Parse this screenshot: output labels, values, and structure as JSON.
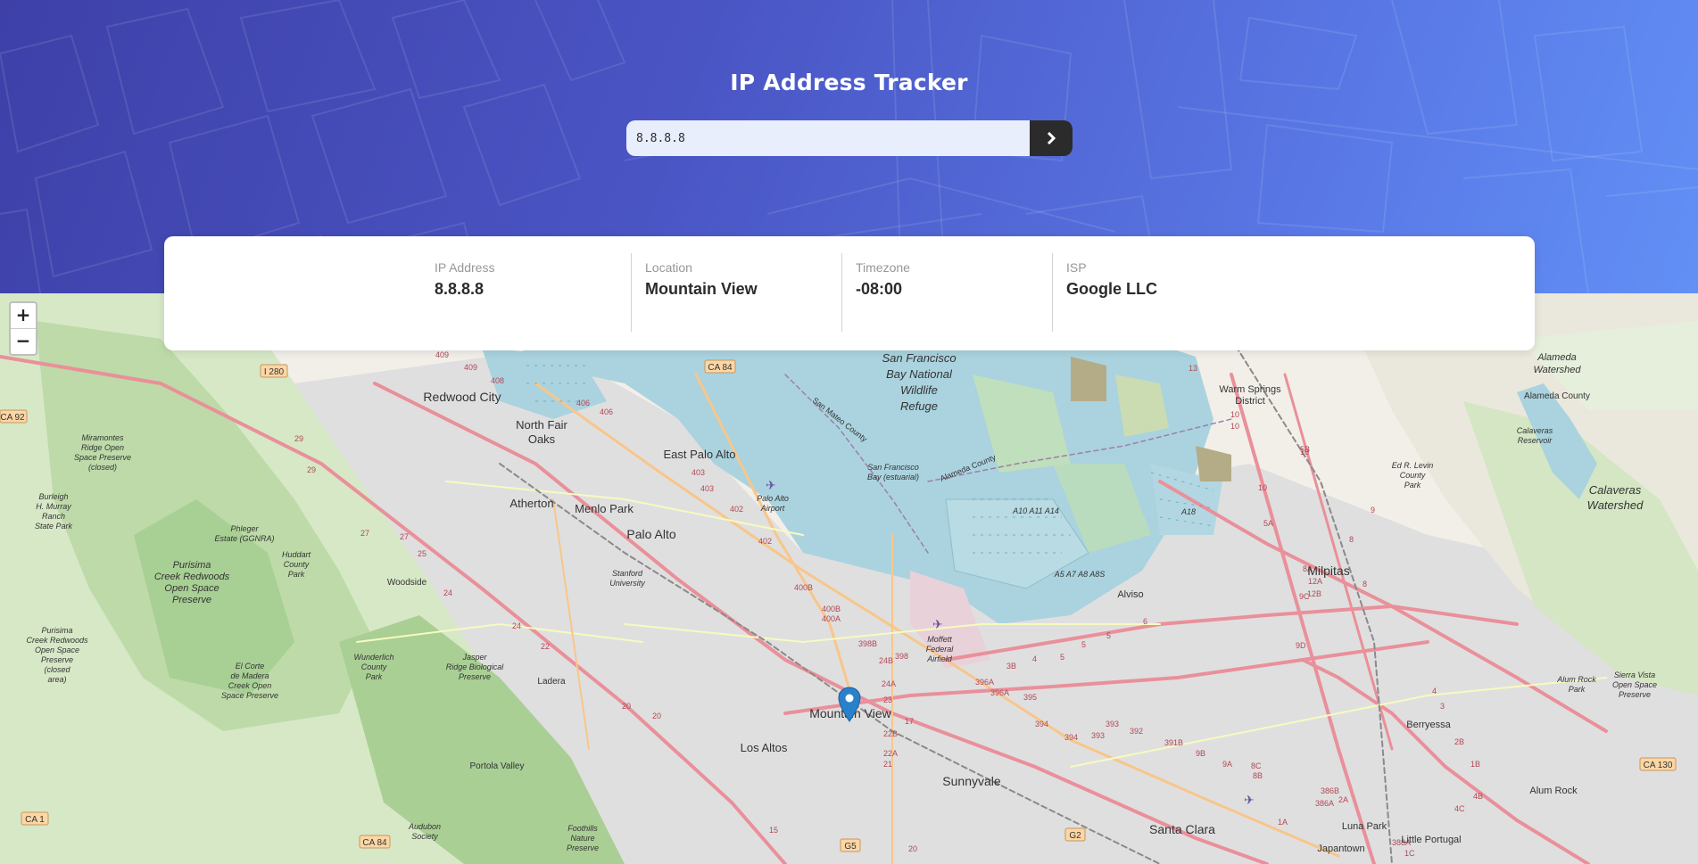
{
  "header": {
    "title": "IP Address Tracker",
    "search": {
      "value": "8.8.8.8",
      "submit_icon": "chevron-right-icon"
    }
  },
  "info": {
    "ip": {
      "label": "IP Address",
      "value": "8.8.8.8"
    },
    "location": {
      "label": "Location",
      "value": "Mountain View"
    },
    "timezone": {
      "label": "Timezone",
      "value": "-08:00"
    },
    "isp": {
      "label": "ISP",
      "value": "Google LLC"
    }
  },
  "map": {
    "zoom_in": "+",
    "zoom_out": "−",
    "marker_icon": "map-pin-icon",
    "labels": {
      "sf_refuge": [
        "San Francisco",
        "Bay National",
        "Wildlife",
        "Refuge"
      ],
      "redwood_city": "Redwood City",
      "north_fair_oaks": [
        "North Fair",
        "Oaks"
      ],
      "east_palo_alto": "East Palo Alto",
      "atherton": "Atherton",
      "menlo_park": "Menlo Park",
      "palo_alto": "Palo Alto",
      "palo_alto_airport": [
        "Palo Alto",
        "Airport"
      ],
      "stanford": [
        "Stanford",
        "University"
      ],
      "woodside": "Woodside",
      "mountain_view": "Mountain View",
      "los_altos": "Los Altos",
      "sunnyvale": "Sunnyvale",
      "santa_clara": "Santa Clara",
      "milpitas": "Milpitas",
      "alviso": "Alviso",
      "berryessa": "Berryessa",
      "alum_rock": "Alum Rock",
      "luna_park": "Luna Park",
      "little_portugal": "Little Portugal",
      "japantown": "Japantown",
      "warm_springs": [
        "Warm Springs",
        "District"
      ],
      "alameda_watershed": [
        "Alameda",
        "Watershed"
      ],
      "alameda_county": "Alameda County",
      "calaveras_watershed": [
        "Calaveras",
        "Watershed"
      ],
      "calaveras_reservoir": [
        "Calaveras",
        "Reservoir"
      ],
      "ed_levin": [
        "Ed R. Levin",
        "County",
        "Park"
      ],
      "moffett": [
        "Moffett",
        "Federal",
        "Airfield"
      ],
      "ladera": "Ladera",
      "portola_valley": "Portola Valley",
      "purisima": [
        "Purisima",
        "Creek Redwoods",
        "Open Space",
        "Preserve"
      ],
      "huddart": [
        "Huddart",
        "County",
        "Park"
      ],
      "phleger": [
        "Phleger",
        "Estate (GGNRA)"
      ],
      "jasper_ridge": [
        "Jasper",
        "Ridge Biological",
        "Preserve"
      ],
      "wunderlich": [
        "Wunderlich",
        "County",
        "Park"
      ],
      "el_corte": [
        "El Corte",
        "de Madera",
        "Creek Open",
        "Space Preserve"
      ],
      "mira_montes": [
        "Miramontes",
        "Ridge Open",
        "Space Preserve",
        "(closed)"
      ],
      "burleigh": [
        "Burleigh",
        "H. Murray",
        "Ranch",
        "State Park"
      ],
      "purisima_closed": [
        "Purisima",
        "Creek Redwoods",
        "Open Space",
        "Preserve",
        "(closed",
        "area)"
      ],
      "audubon": [
        "Audubon",
        "Society"
      ],
      "foothills": [
        "Foothills",
        "Nature",
        "Preserve"
      ],
      "alum_rock_park": [
        "Alum Rock",
        "Park"
      ],
      "sierra_vista": [
        "Sierra Vista",
        "Open Space",
        "Preserve"
      ],
      "sf_bay_estuarial": [
        "San Francisco",
        "Bay (estuarial)"
      ],
      "san_mateo_county": "San Mateo County",
      "alameda_county_line": "Alameda County",
      "a10": "A10 A11 A14",
      "a18": "A18",
      "a5": "A5 A7 A8 A8S"
    },
    "shields": [
      "I 280",
      "CA 84",
      "CA 92",
      "CA 1",
      "CA 84",
      "G5",
      "G2",
      "CA 130"
    ],
    "route_numbers": [
      "409",
      "409",
      "408",
      "406",
      "406",
      "29",
      "29",
      "27",
      "27",
      "25",
      "24",
      "24",
      "22",
      "20",
      "20",
      "403",
      "403",
      "402",
      "402",
      "400B",
      "400B",
      "400A",
      "398B",
      "398",
      "24B",
      "24A",
      "23",
      "22B",
      "22A",
      "21",
      "17",
      "15",
      "20",
      "13",
      "10",
      "10",
      "9",
      "8",
      "8",
      "6",
      "5",
      "5",
      "5",
      "4",
      "3B",
      "396A",
      "396A",
      "395",
      "394",
      "394",
      "393",
      "393",
      "392",
      "391B",
      "9B",
      "9A",
      "8C",
      "8B",
      "8A",
      "9C",
      "9D",
      "12A",
      "12B",
      "10",
      "10",
      "5B",
      "5A",
      "4",
      "3",
      "2B",
      "1B",
      "4B",
      "4C",
      "386A",
      "386B",
      "388A",
      "1C",
      "2A",
      "1A"
    ]
  }
}
